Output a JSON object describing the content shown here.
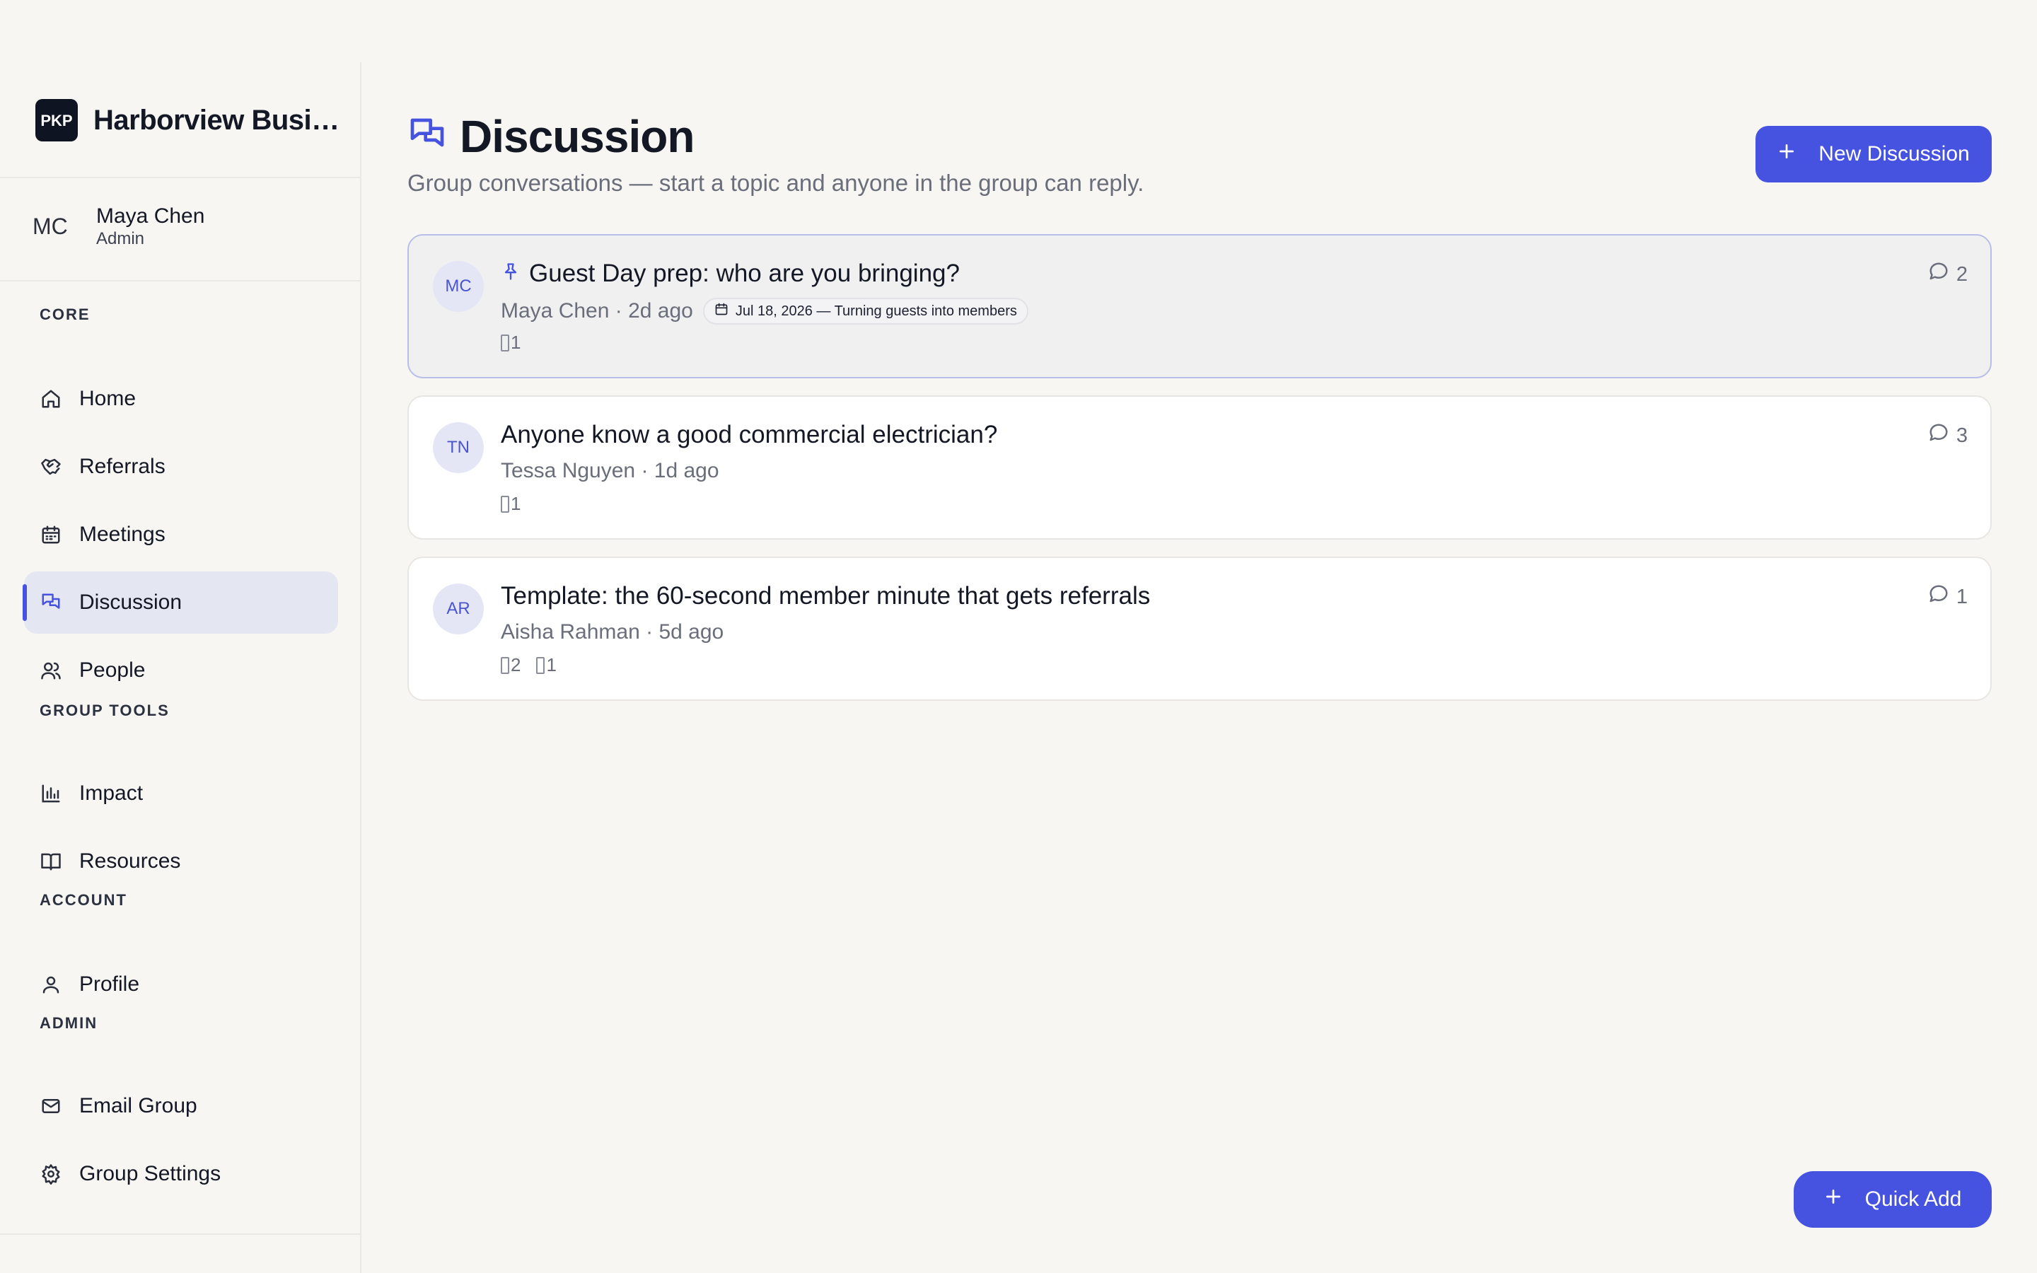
{
  "sidebar": {
    "brand": {
      "logo_text": "PKP",
      "name": "Harborview Busi…"
    },
    "user": {
      "initials": "MC",
      "name": "Maya Chen",
      "role": "Admin"
    },
    "sections": {
      "core": "CORE",
      "group_tools": "GROUP TOOLS",
      "account": "ACCOUNT",
      "admin": "ADMIN"
    },
    "items": {
      "home": "Home",
      "referrals": "Referrals",
      "meetings": "Meetings",
      "discussion": "Discussion",
      "people": "People",
      "impact": "Impact",
      "resources": "Resources",
      "profile": "Profile",
      "email_group": "Email Group",
      "group_settings": "Group Settings"
    },
    "active_item": "discussion"
  },
  "header": {
    "title": "Discussion",
    "subtitle": "Group conversations — start a topic and anyone in the group can reply.",
    "new_button": "New Discussion"
  },
  "threads": [
    {
      "initials": "MC",
      "pinned": true,
      "title": "Guest Day prep: who are you bringing?",
      "author": "Maya Chen",
      "age": "· 2d ago",
      "event": "Jul 18, 2026 — Turning guests into members",
      "reactions": [
        "1"
      ],
      "replies": "2"
    },
    {
      "initials": "TN",
      "pinned": false,
      "title": "Anyone know a good commercial electrician?",
      "author": "Tessa Nguyen",
      "age": "· 1d ago",
      "reactions": [
        "1"
      ],
      "replies": "3"
    },
    {
      "initials": "AR",
      "pinned": false,
      "title": "Template: the 60-second member minute that gets referrals",
      "author": "Aisha Rahman",
      "age": "· 5d ago",
      "reactions": [
        "2",
        "1"
      ],
      "replies": "1"
    }
  ],
  "quick_add": "Quick Add",
  "colors": {
    "accent": "#4652e0",
    "background": "#f7f6f3",
    "active_nav": "#e4e6f2",
    "pinned_card": "#f0f0f1"
  }
}
